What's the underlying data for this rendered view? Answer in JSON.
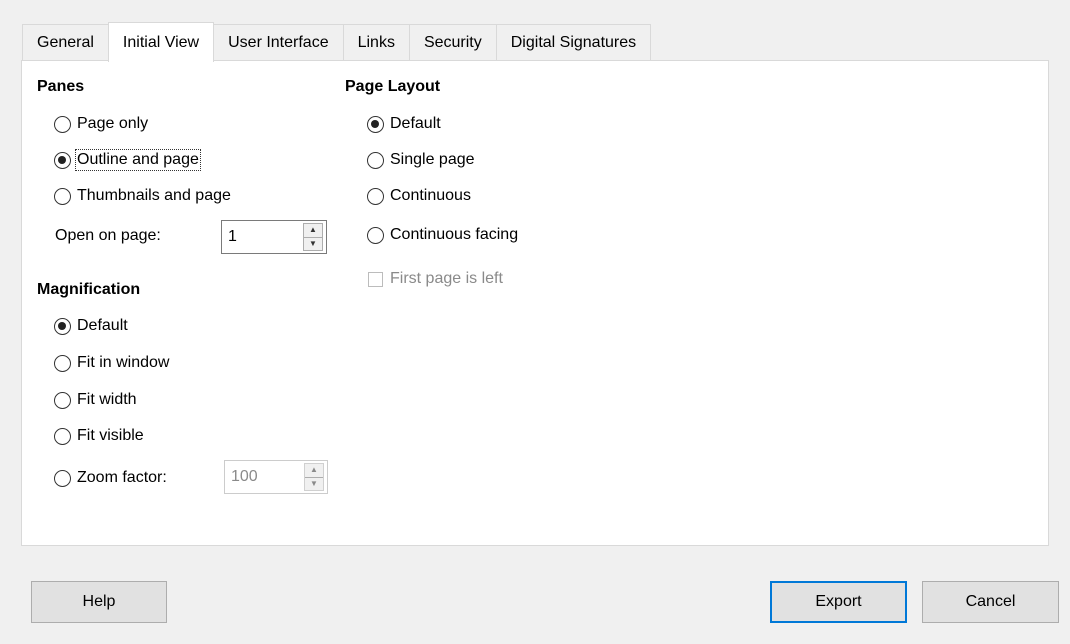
{
  "tabs": [
    "General",
    "Initial View",
    "User Interface",
    "Links",
    "Security",
    "Digital Signatures"
  ],
  "active_tab": "Initial View",
  "panes": {
    "heading": "Panes",
    "options": [
      "Page only",
      "Outline and page",
      "Thumbnails and page"
    ],
    "selected": "Outline and page",
    "open_on_page_label": "Open on page:",
    "open_on_page_value": "1"
  },
  "magnification": {
    "heading": "Magnification",
    "options": [
      "Default",
      "Fit in window",
      "Fit width",
      "Fit visible",
      "Zoom factor:"
    ],
    "selected": "Default",
    "zoom_value": "100"
  },
  "page_layout": {
    "heading": "Page Layout",
    "options": [
      "Default",
      "Single page",
      "Continuous",
      "Continuous facing"
    ],
    "selected": "Default",
    "first_page_left_label": "First page is left",
    "first_page_left_checked": false
  },
  "buttons": {
    "help": "Help",
    "export": "Export",
    "cancel": "Cancel"
  }
}
